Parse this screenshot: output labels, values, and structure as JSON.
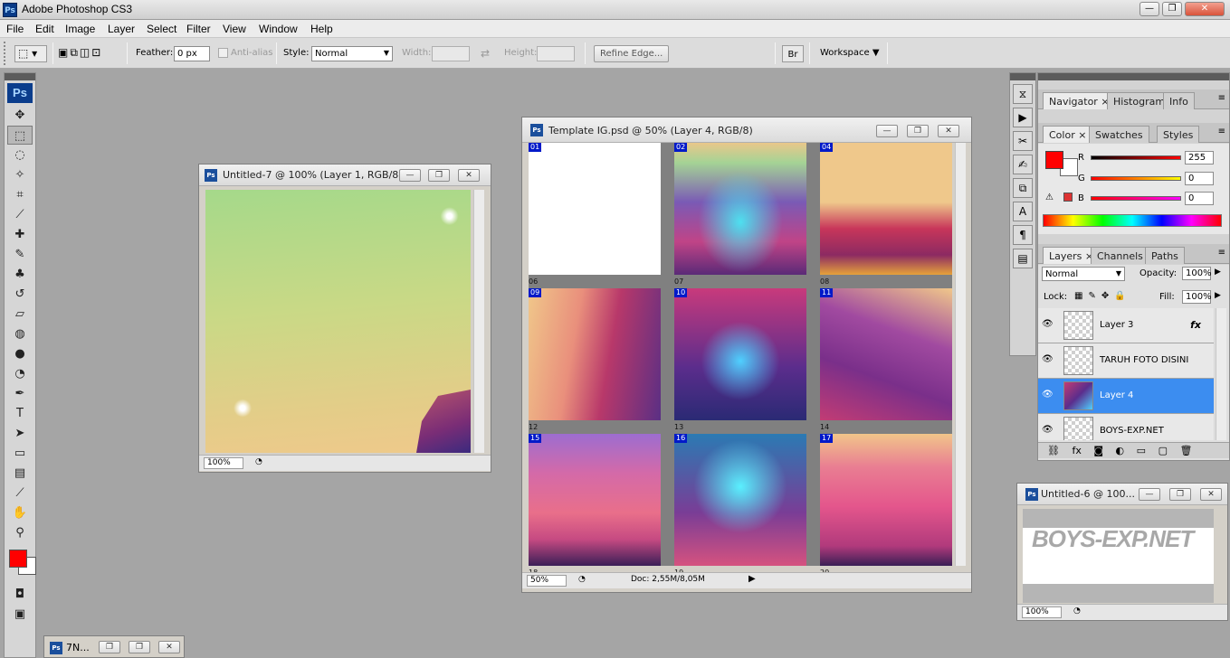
{
  "app": {
    "title": "Adobe Photoshop CS3",
    "logo_text": "Ps",
    "window_buttons": [
      "—",
      "❐",
      "✕"
    ]
  },
  "menu": [
    "File",
    "Edit",
    "Image",
    "Layer",
    "Select",
    "Filter",
    "View",
    "Window",
    "Help"
  ],
  "options": {
    "feather_label": "Feather:",
    "feather_value": "0 px",
    "antialias_label": "Anti-alias",
    "style_label": "Style:",
    "style_value": "Normal",
    "width_label": "Width:",
    "height_label": "Height:",
    "refine_edge": "Refine Edge...",
    "workspace": "Workspace"
  },
  "toolbox": {
    "logo": "Ps",
    "tools": [
      {
        "icon": "move-icon",
        "glyph": "✥"
      },
      {
        "icon": "marquee-icon",
        "glyph": "⬚",
        "active": true
      },
      {
        "icon": "lasso-icon",
        "glyph": "◌"
      },
      {
        "icon": "magic-wand-icon",
        "glyph": "✧"
      },
      {
        "icon": "crop-icon",
        "glyph": "⌗"
      },
      {
        "icon": "slice-icon",
        "glyph": "⟋"
      },
      {
        "icon": "healing-brush-icon",
        "glyph": "✚"
      },
      {
        "icon": "brush-icon",
        "glyph": "✎"
      },
      {
        "icon": "clone-stamp-icon",
        "glyph": "♣"
      },
      {
        "icon": "history-brush-icon",
        "glyph": "↺"
      },
      {
        "icon": "eraser-icon",
        "glyph": "▱"
      },
      {
        "icon": "paint-bucket-icon",
        "glyph": "◍"
      },
      {
        "icon": "blur-icon",
        "glyph": "●"
      },
      {
        "icon": "dodge-icon",
        "glyph": "◔"
      },
      {
        "icon": "pen-icon",
        "glyph": "✒"
      },
      {
        "icon": "type-icon",
        "glyph": "T"
      },
      {
        "icon": "path-selection-icon",
        "glyph": "➤"
      },
      {
        "icon": "rectangle-shape-icon",
        "glyph": "▭"
      },
      {
        "icon": "notes-icon",
        "glyph": "▤"
      },
      {
        "icon": "eyedropper-icon",
        "glyph": "⟋"
      },
      {
        "icon": "hand-icon",
        "glyph": "✋"
      },
      {
        "icon": "zoom-icon",
        "glyph": "⚲"
      }
    ],
    "foreground_color": "#ff0000",
    "background_color": "#ffffff"
  },
  "doc_untitled7": {
    "title": "Untitled-7 @ 100% (Layer 1, RGB/8)",
    "zoom": "100%"
  },
  "doc_template": {
    "title": "Template IG.psd @ 50% (Layer 4, RGB/8)",
    "zoom": "50%",
    "doc_info": "Doc: 2,55M/8,05M",
    "tiles": [
      {
        "num": "01",
        "sub": "06",
        "style": "t-white"
      },
      {
        "num": "02",
        "sub": "07",
        "style": "t-sky-galaxy"
      },
      {
        "num": "04",
        "sub": "08",
        "style": "t-sky-rock"
      },
      {
        "num": "09",
        "sub": "12",
        "style": "t-rock-left"
      },
      {
        "num": "10",
        "sub": "13",
        "style": "t-cosmic"
      },
      {
        "num": "11",
        "sub": "14",
        "style": "t-rock-right"
      },
      {
        "num": "15",
        "sub": "18",
        "style": "t-horse"
      },
      {
        "num": "16",
        "sub": "19",
        "style": "t-cosmic-blue"
      },
      {
        "num": "17",
        "sub": "20",
        "style": "t-ground-pink"
      }
    ]
  },
  "doc_untitled6": {
    "title": "Untitled-6 @ 100...",
    "zoom": "100%",
    "image_text": "BOYS-EXP.NET"
  },
  "doc_minimized": {
    "title": "7N..."
  },
  "panels": {
    "nav_tabs": [
      "Navigator",
      "Histogram",
      "Info"
    ],
    "color_tabs": [
      "Color",
      "Swatches",
      "Styles"
    ],
    "color": {
      "r_label": "R",
      "r_value": "255",
      "g_label": "G",
      "g_value": "0",
      "b_label": "B",
      "b_value": "0",
      "swatch": "#ff0000"
    },
    "layers_tabs": [
      "Layers",
      "Channels",
      "Paths"
    ],
    "blend_mode": "Normal",
    "opacity_label": "Opacity:",
    "opacity_value": "100%",
    "lock_label": "Lock:",
    "fill_label": "Fill:",
    "fill_value": "100%",
    "layers": [
      {
        "name": "Layer 3",
        "fx": true,
        "selected": false
      },
      {
        "name": "TARUH FOTO DISINI",
        "fx": false,
        "selected": false
      },
      {
        "name": "Layer 4",
        "fx": false,
        "selected": true
      },
      {
        "name": "BOYS-EXP.NET",
        "fx": false,
        "selected": false
      }
    ]
  }
}
